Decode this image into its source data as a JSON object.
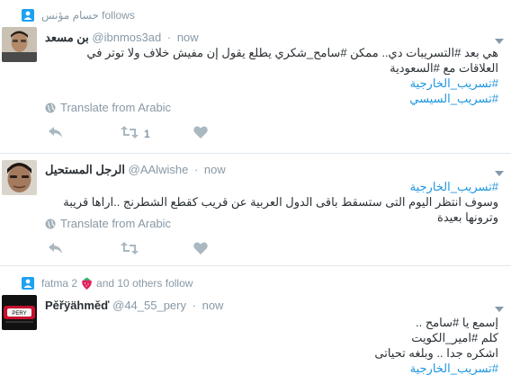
{
  "tweets": [
    {
      "context": {
        "names": "حسام مؤنس",
        "suffix": "follows"
      },
      "author": {
        "name": "بن مسعد",
        "handle": "@ibnmos3ad",
        "time": "now"
      },
      "lines": [
        "هي بعد #التسريبات دي.. ممكن #سامح_شكري يطلع يقول إن مفيش خلاف ولا توتر في العلاقات مع #السعودية",
        "#تسريب_الخارجية",
        "#تسريب_السيسي"
      ],
      "translate": "Translate from Arabic",
      "retweet_count": "1"
    },
    {
      "author": {
        "name": "الرجل المستحيل",
        "handle": "@AAlwishe",
        "time": "now"
      },
      "lines": [
        "#تسريب_الخارجية",
        "وسوف انتظر اليوم التى ستسقط باقى الدول العربية عن قريب كقطع الشطرنج ..اراها قريبة وترونها بعيدة"
      ],
      "translate": "Translate from Arabic"
    },
    {
      "context": {
        "names": "fatma 2",
        "suffix": "and 10 others follow"
      },
      "author": {
        "name": "Pěřÿähměď",
        "handle": "@44_55_pery",
        "time": "now"
      },
      "lines": [
        "إسمع يا #سامح ..",
        "كلم #امير_الكويت",
        "اشكره جدا .. وبلغه تحياتى",
        "#تسريب_الخارجية"
      ]
    }
  ],
  "colors": {
    "link": "#1b95e0",
    "muted": "#8899a6",
    "text": "#292f33",
    "divider": "#e1e8ed"
  }
}
